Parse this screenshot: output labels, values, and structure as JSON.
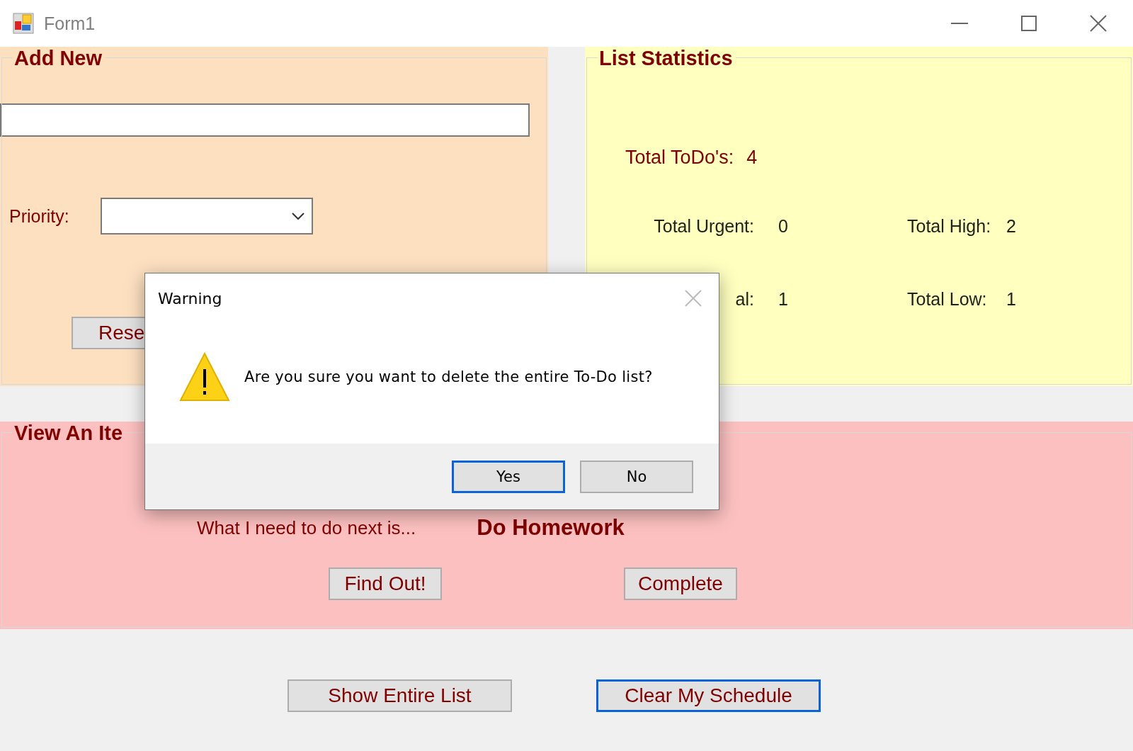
{
  "window": {
    "title": "Form1"
  },
  "add_new": {
    "title": "Add New",
    "priority_label": "Priority:",
    "reset_button": "Rese"
  },
  "statistics": {
    "title": "List Statistics",
    "total": {
      "label": "Total ToDo's:",
      "value": "4"
    },
    "rows": [
      {
        "label": "Total Urgent:",
        "value": "0"
      },
      {
        "label": "Total High:",
        "value": "2"
      },
      {
        "label": "al:",
        "value": "1"
      },
      {
        "label": "Total Low:",
        "value": "1"
      }
    ]
  },
  "view_item": {
    "title": "View An Ite",
    "prompt": "What I need to do next is...",
    "next_item": "Do Homework",
    "buttons": [
      "Find Out!",
      "Complete"
    ]
  },
  "bottom_buttons": [
    {
      "label": "Show Entire List",
      "focused": false
    },
    {
      "label": "Clear My Schedule",
      "focused": true
    }
  ],
  "dialog": {
    "title": "Warning",
    "message": "Are you sure you want to delete the entire To-Do list?",
    "buttons": [
      {
        "label": "Yes",
        "focused": true
      },
      {
        "label": "No",
        "focused": false
      }
    ]
  }
}
